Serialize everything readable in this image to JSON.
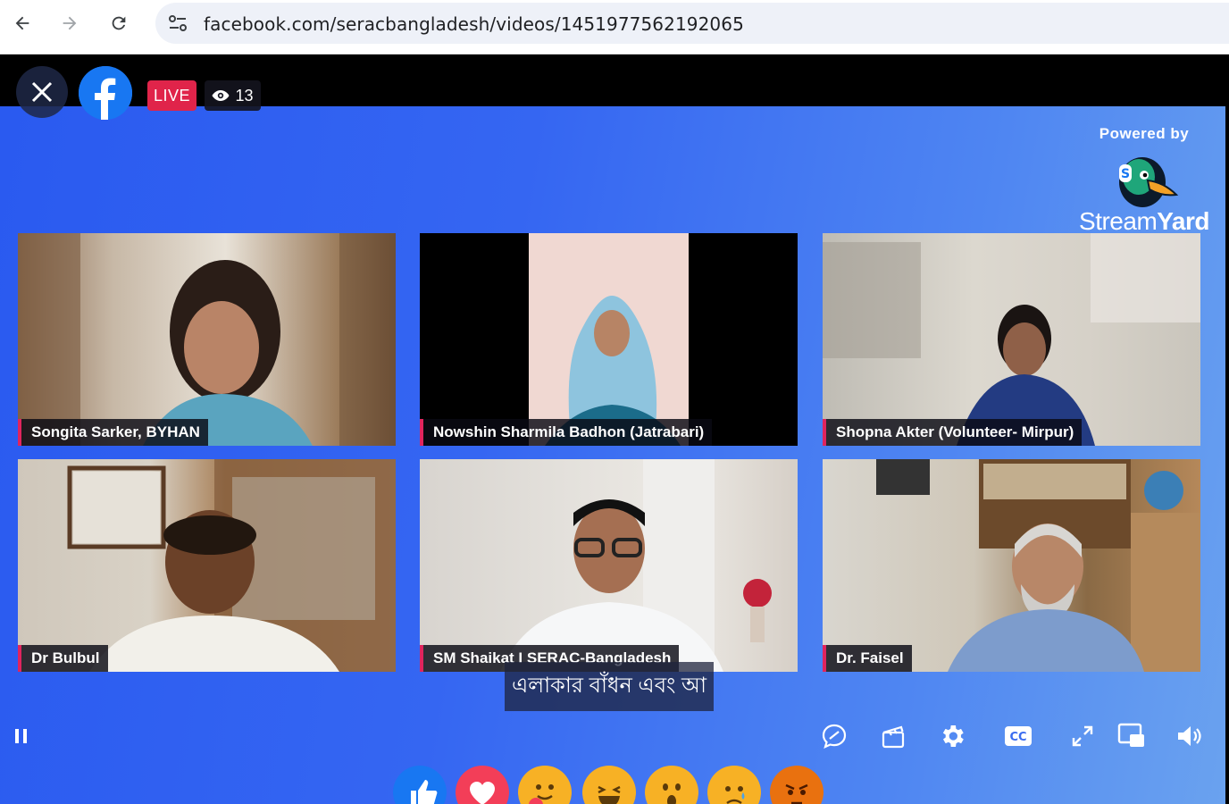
{
  "browser": {
    "url": "facebook.com/seracbangladesh/videos/1451977562192065"
  },
  "player": {
    "live_label": "LIVE",
    "viewer_count": "13",
    "powered_by": "Powered by",
    "brand_light": "Stream",
    "brand_bold": "Yard",
    "caption": "এলাকার বাঁধন এবং আ",
    "participants": [
      {
        "name": "Songita Sarker, BYHAN"
      },
      {
        "name": "Nowshin Sharmila Badhon (Jatrabari)"
      },
      {
        "name": "Shopna Akter (Volunteer- Mirpur)"
      },
      {
        "name": "Dr Bulbul"
      },
      {
        "name": "SM Shaikat I SERAC-Bangladesh"
      },
      {
        "name": "Dr. Faisel"
      }
    ]
  },
  "colors": {
    "accent": "#e0245e",
    "facebook_blue": "#1877f2",
    "live_red": "#e0244a"
  }
}
